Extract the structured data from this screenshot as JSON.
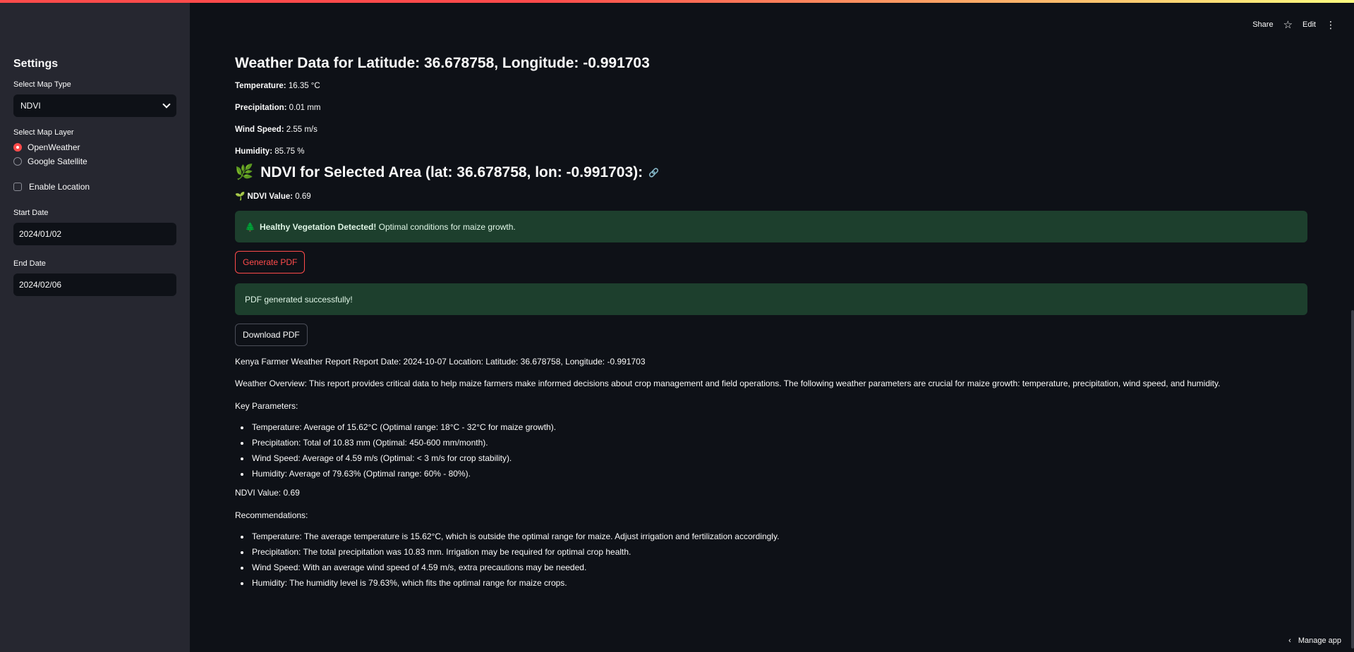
{
  "header": {
    "share": "Share",
    "edit": "Edit",
    "more": "⋮",
    "star": "☆"
  },
  "sidebar": {
    "title": "Settings",
    "map_type_label": "Select Map Type",
    "map_type_value": "NDVI",
    "map_layer_label": "Select Map Layer",
    "layer_options": [
      "OpenWeather",
      "Google Satellite"
    ],
    "enable_location": "Enable Location",
    "start_date_label": "Start Date",
    "start_date": "2024/01/02",
    "end_date_label": "End Date",
    "end_date": "2024/02/06"
  },
  "weather": {
    "title": "Weather Data for Latitude: 36.678758, Longitude: -0.991703",
    "temp_label": "Temperature:",
    "temp_value": " 16.35 °C",
    "precip_label": "Precipitation:",
    "precip_value": " 0.01 mm",
    "wind_label": "Wind Speed:",
    "wind_value": " 2.55 m/s",
    "humidity_label": "Humidity:",
    "humidity_value": " 85.75 %"
  },
  "ndvi": {
    "emoji": "🌿",
    "title": "NDVI for Selected Area (lat: 36.678758, lon: -0.991703):",
    "value_emoji": "🌱",
    "value_label": "NDVI Value:",
    "value": " 0.69"
  },
  "alerts": {
    "veg_emoji": "🌲",
    "veg_bold": "Healthy Vegetation Detected!",
    "veg_text": " Optimal conditions for maize growth.",
    "pdf_success": "PDF generated successfully!"
  },
  "buttons": {
    "generate": "Generate PDF",
    "download": "Download PDF"
  },
  "report": {
    "line1": "Kenya Farmer Weather Report Report Date: 2024-10-07 Location: Latitude: 36.678758, Longitude: -0.991703",
    "overview": "Weather Overview: This report provides critical data to help maize farmers make informed decisions about crop management and field operations. The following weather parameters are crucial for maize growth: temperature, precipitation, wind speed, and humidity.",
    "key_params_title": "Key Parameters:",
    "key_params": [
      "Temperature: Average of 15.62°C (Optimal range: 18°C - 32°C for maize growth).",
      "Precipitation: Total of 10.83 mm (Optimal: 450-600 mm/month).",
      "Wind Speed: Average of 4.59 m/s (Optimal: < 3 m/s for crop stability).",
      "Humidity: Average of 79.63% (Optimal range: 60% - 80%)."
    ],
    "ndvi_line": "NDVI Value: 0.69",
    "recs_title": "Recommendations:",
    "recs": [
      "Temperature: The average temperature is 15.62°C, which is outside the optimal range for maize. Adjust irrigation and fertilization accordingly.",
      "Precipitation: The total precipitation was 10.83 mm. Irrigation may be required for optimal crop health.",
      "Wind Speed: With an average wind speed of 4.59 m/s, extra precautions may be needed.",
      "Humidity: The humidity level is 79.63%, which fits the optimal range for maize crops."
    ]
  },
  "footer": {
    "manage": "Manage app"
  }
}
